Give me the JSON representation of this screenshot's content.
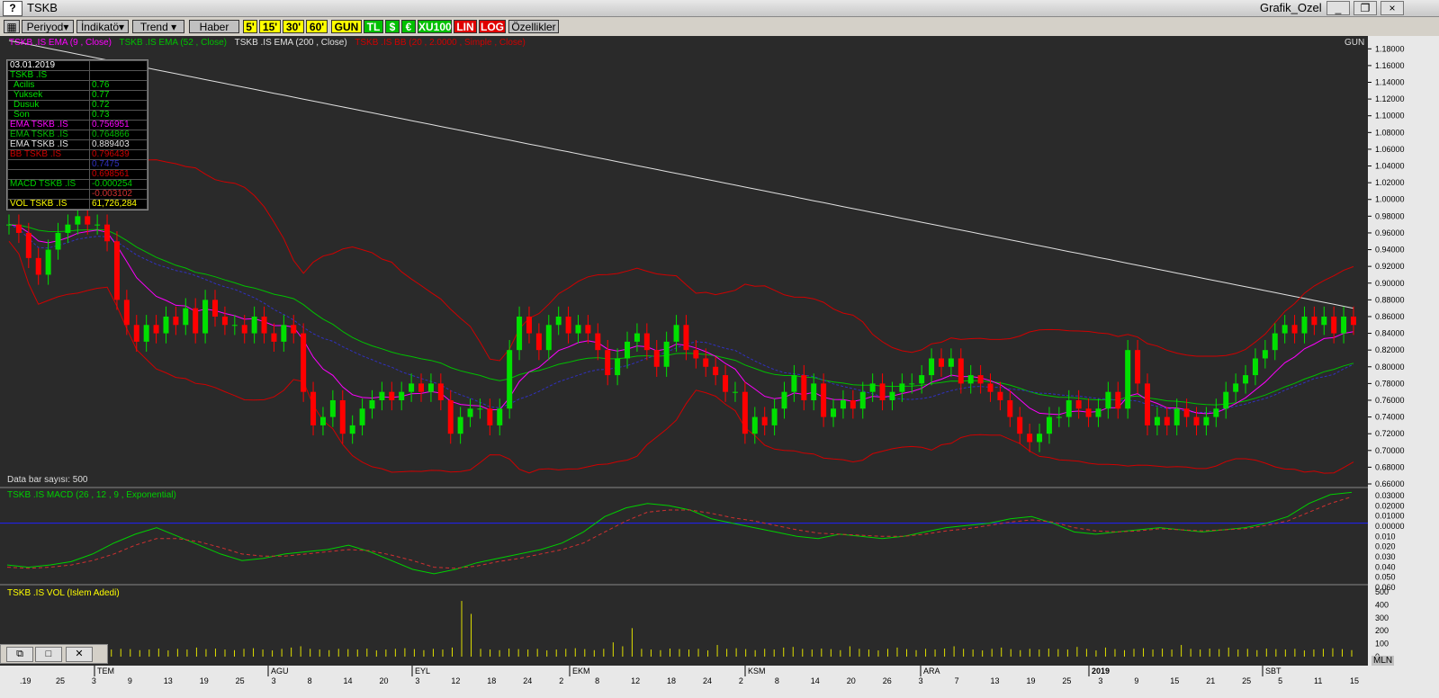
{
  "window": {
    "app_title": "TSKB",
    "help_label": "?",
    "chart_window_title": "Grafik_Ozel",
    "minimize_label": "_",
    "restore_label": "❐",
    "close_label": "×"
  },
  "toolbar": {
    "periyod": "Periyod▾",
    "indikator": "İndikatö▾",
    "trend": "Trend ▾",
    "haber": "Haber",
    "p5": "5'",
    "p15": "15'",
    "p30": "30'",
    "p60": "60'",
    "gun": "GUN",
    "tl": "TL",
    "s": "$",
    "euro": "€",
    "xu100": "XU100",
    "lin": "LIN",
    "log": "LOG",
    "ozellikler": "Özellikler"
  },
  "legend": {
    "ema9": "TSKB .IS EMA (9 , Close)",
    "ema52": "TSKB .IS EMA (52 , Close)",
    "ema200": "TSKB .IS EMA (200 , Close)",
    "bb": "TSKB .IS BB (20 , 2.0000 , Simple , Close)",
    "period": "GUN"
  },
  "info": {
    "date": "03.01.2019",
    "symbol": "TSKB .IS",
    "acilis_label": "Acilis",
    "acilis": "0.76",
    "yuksek_label": "Yuksek",
    "yuksek": "0.77",
    "dusuk_label": "Dusuk",
    "dusuk": "0.72",
    "son_label": "Son",
    "son": "0.73",
    "ema9_label": "EMA TSKB .IS",
    "ema9": "0.756951",
    "ema52_label": "EMA TSKB .IS",
    "ema52": "0.764866",
    "ema200_label": "EMA TSKB .IS",
    "ema200": "0.889403",
    "bb_label": "BB TSKB .IS",
    "bb_up": "0.796439",
    "bb_mid": "0.7475",
    "bb_low": "0.698561",
    "macd_label": "MACD TSKB .IS",
    "macd": "-0.000254",
    "macd_sig": "-0.003102",
    "vol_label": "VOL TSKB .IS",
    "vol": "61,726,284"
  },
  "data_bar_label": "Data bar sayısı: 500",
  "macd_title": "TSKB .IS MACD (26 , 12 , 9 , Exponential)",
  "vol_title": "TSKB .IS VOL (Islem Adedi)",
  "mln_label": "MLN",
  "colors": {
    "up": "#00e000",
    "down": "#ff0000",
    "ema9": "#ff00ff",
    "ema52": "#00c000",
    "ema200": "#e0e0e0",
    "bb": "#d00000",
    "bbmid": "#3030c0",
    "vol": "#e0e000",
    "macd": "#00d000",
    "signal": "#d03030",
    "zero": "#2020ff"
  },
  "chart_data": [
    {
      "type": "candlestick",
      "title": "TSKB",
      "ylim": [
        0.66,
        1.19
      ],
      "y_ticks": [
        "1.18000",
        "1.16000",
        "1.14000",
        "1.12000",
        "1.10000",
        "1.08000",
        "1.06000",
        "1.04000",
        "1.02000",
        "1.00000",
        "0.98000",
        "0.96000",
        "0.94000",
        "0.92000",
        "0.90000",
        "0.88000",
        "0.86000",
        "0.84000",
        "0.82000",
        "0.80000",
        "0.78000",
        "0.76000",
        "0.74000",
        "0.72000",
        "0.70000",
        "0.68000",
        "0.66000"
      ],
      "x_month_labels": [
        "TEM",
        "AGU",
        "EYL",
        "EKM",
        "KSM",
        "ARA",
        "2019",
        "SBT"
      ],
      "x_day_labels": [
        ".19",
        "25",
        "3",
        "9",
        "13",
        "19",
        "25",
        "3",
        "8",
        "14",
        "20",
        "3",
        "12",
        "18",
        "24",
        "2",
        "8",
        "12",
        "18",
        "24",
        "2",
        "8",
        "14",
        "20",
        "26",
        "3",
        "7",
        "13",
        "19",
        "25",
        "3",
        "9",
        "15",
        "21",
        "25",
        "5",
        "11",
        "15"
      ],
      "close": [
        0.97,
        0.96,
        0.93,
        0.91,
        0.94,
        0.96,
        0.97,
        0.98,
        0.97,
        0.97,
        0.95,
        0.88,
        0.85,
        0.83,
        0.85,
        0.84,
        0.86,
        0.85,
        0.87,
        0.84,
        0.88,
        0.86,
        0.85,
        0.85,
        0.84,
        0.86,
        0.84,
        0.83,
        0.85,
        0.84,
        0.77,
        0.73,
        0.74,
        0.76,
        0.72,
        0.73,
        0.75,
        0.76,
        0.77,
        0.76,
        0.77,
        0.78,
        0.77,
        0.78,
        0.76,
        0.72,
        0.74,
        0.75,
        0.75,
        0.73,
        0.75,
        0.82,
        0.86,
        0.84,
        0.82,
        0.85,
        0.86,
        0.84,
        0.85,
        0.84,
        0.82,
        0.79,
        0.81,
        0.83,
        0.84,
        0.82,
        0.8,
        0.83,
        0.85,
        0.82,
        0.81,
        0.8,
        0.79,
        0.77,
        0.77,
        0.72,
        0.74,
        0.73,
        0.75,
        0.77,
        0.79,
        0.76,
        0.78,
        0.74,
        0.75,
        0.76,
        0.75,
        0.77,
        0.78,
        0.76,
        0.77,
        0.78,
        0.78,
        0.79,
        0.81,
        0.8,
        0.81,
        0.78,
        0.79,
        0.78,
        0.77,
        0.76,
        0.74,
        0.72,
        0.71,
        0.72,
        0.74,
        0.74,
        0.76,
        0.75,
        0.74,
        0.75,
        0.77,
        0.75,
        0.82,
        0.78,
        0.73,
        0.74,
        0.73,
        0.75,
        0.74,
        0.73,
        0.74,
        0.75,
        0.77,
        0.78,
        0.79,
        0.81,
        0.82,
        0.84,
        0.85,
        0.84,
        0.86,
        0.85,
        0.86,
        0.84,
        0.86,
        0.85
      ]
    },
    {
      "type": "line",
      "title": "TSKB .IS MACD (26 , 12 , 9 , Exponential)",
      "ylim": [
        -0.06,
        0.03
      ],
      "y_ticks": [
        "0.03000",
        "0.02000",
        "0.01000",
        "0.00000",
        "0.010",
        "0.020",
        "0.030",
        "0.040",
        "0.050",
        "0.060"
      ],
      "series": [
        {
          "name": "MACD",
          "values": [
            -0.038,
            -0.04,
            -0.038,
            -0.035,
            -0.028,
            -0.018,
            -0.01,
            -0.004,
            -0.012,
            -0.02,
            -0.028,
            -0.034,
            -0.032,
            -0.028,
            -0.026,
            -0.024,
            -0.02,
            -0.026,
            -0.034,
            -0.042,
            -0.046,
            -0.042,
            -0.036,
            -0.032,
            -0.028,
            -0.024,
            -0.018,
            -0.008,
            0.006,
            0.014,
            0.018,
            0.016,
            0.012,
            0.004,
            0.0,
            -0.004,
            -0.008,
            -0.012,
            -0.014,
            -0.01,
            -0.012,
            -0.014,
            -0.012,
            -0.008,
            -0.004,
            -0.002,
            0.0,
            0.004,
            0.006,
            0.0,
            -0.008,
            -0.01,
            -0.008,
            -0.006,
            -0.004,
            -0.006,
            -0.008,
            -0.006,
            -0.004,
            0.0,
            0.006,
            0.018,
            0.026,
            0.028
          ]
        },
        {
          "name": "Signal",
          "values": [
            -0.04,
            -0.041,
            -0.04,
            -0.038,
            -0.034,
            -0.028,
            -0.02,
            -0.014,
            -0.014,
            -0.017,
            -0.022,
            -0.028,
            -0.03,
            -0.03,
            -0.028,
            -0.026,
            -0.024,
            -0.025,
            -0.029,
            -0.034,
            -0.04,
            -0.041,
            -0.039,
            -0.035,
            -0.032,
            -0.028,
            -0.024,
            -0.018,
            -0.008,
            0.002,
            0.01,
            0.012,
            0.012,
            0.009,
            0.005,
            0.002,
            -0.002,
            -0.006,
            -0.009,
            -0.01,
            -0.011,
            -0.012,
            -0.012,
            -0.01,
            -0.007,
            -0.005,
            -0.002,
            0.001,
            0.003,
            0.001,
            -0.004,
            -0.007,
            -0.008,
            -0.007,
            -0.005,
            -0.006,
            -0.007,
            -0.006,
            -0.005,
            -0.002,
            0.002,
            0.01,
            0.018,
            0.024
          ]
        }
      ]
    },
    {
      "type": "bar",
      "title": "TSKB .IS VOL (Islem Adedi)",
      "ylim": [
        0,
        500
      ],
      "y_ticks": [
        "500",
        "400",
        "300",
        "200",
        "100",
        "0"
      ],
      "values": [
        60,
        55,
        70,
        58,
        50,
        62,
        45,
        60,
        55,
        65,
        70,
        55,
        60,
        58,
        50,
        55,
        62,
        48,
        60,
        55,
        70,
        58,
        62,
        55,
        50,
        60,
        65,
        55,
        48,
        60,
        70,
        80,
        60,
        55,
        50,
        60,
        58,
        55,
        62,
        48,
        55,
        60,
        65,
        58,
        50,
        60,
        55,
        70,
        430,
        330,
        60,
        55,
        50,
        62,
        58,
        55,
        60,
        48,
        55,
        60,
        65,
        58,
        50,
        60,
        110,
        80,
        220,
        60,
        55,
        50,
        62,
        58,
        55,
        60,
        48,
        90,
        60,
        65,
        58,
        50,
        60,
        55,
        70,
        75,
        60,
        55,
        62,
        58,
        50,
        80,
        60,
        55,
        48,
        60,
        70,
        58,
        50,
        60,
        55,
        62,
        80,
        60,
        55,
        48,
        60,
        70,
        58,
        50,
        60,
        55,
        62,
        58,
        55,
        75,
        60,
        48,
        70,
        58,
        50,
        60,
        65,
        55,
        62,
        55,
        90,
        60,
        55,
        62,
        58,
        70,
        55,
        60,
        50,
        62,
        58,
        55,
        60,
        48,
        55,
        60,
        65,
        58,
        50
      ]
    }
  ]
}
